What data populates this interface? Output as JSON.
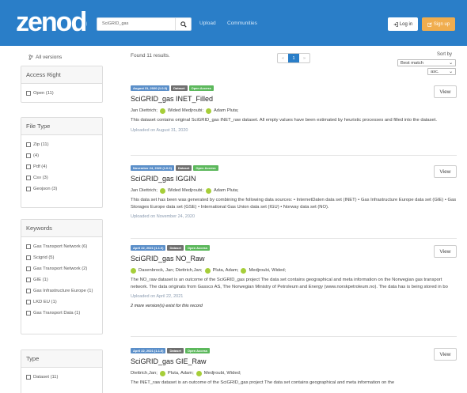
{
  "header": {
    "logo_text": "zenodo",
    "search_value": "SciGRID_gas",
    "search_icon": "search-icon",
    "nav": [
      "Upload",
      "Communities"
    ],
    "login_label": "Log in",
    "signup_label": "Sign up",
    "colors": {
      "header_bg": "#2a7ec8",
      "signup_bg": "#f0ad4e"
    }
  },
  "sidebar": {
    "all_versions": "All versions",
    "access_right": {
      "title": "Access Right",
      "items": [
        "Open (11)"
      ]
    },
    "file_type": {
      "title": "File Type",
      "items": [
        "Zip (11)",
        "(4)",
        "Pdf (4)",
        "Csv (3)",
        "Geojson (3)"
      ]
    },
    "keywords": {
      "title": "Keywords",
      "items": [
        "Gas Transport Network (6)",
        "Scigrid (5)",
        "Gas Transport Network (2)",
        "GIE (1)",
        "Gas Infrastructure Europe (1)",
        "LKD EU (1)",
        "Gas Transport Data (1)"
      ]
    },
    "type": {
      "title": "Type",
      "items": [
        "Dataset (11)"
      ]
    }
  },
  "results": {
    "found_text": "Found 11 results.",
    "pager": {
      "prev": "«",
      "current": "1",
      "next": "»"
    },
    "sort_by_label": "Sort by",
    "sort_value": "Best match",
    "order_value": "asc."
  },
  "records": [
    {
      "date_badge": "August 31, 2020 (1.0.0)",
      "type_badge": "Dataset",
      "access_badge": "Open Access",
      "title": "SciGRID_gas INET_Filled",
      "authors": [
        "Jan Diettrich;",
        "Wided Medjroubi;",
        "Adam Pluta;"
      ],
      "orcid_flags": [
        false,
        true,
        true
      ],
      "description": "This dataset contains original SciGRID_gas INET_raw dataset. All empty values have been estimated by heuristic processes and filled into the dataset.",
      "uploaded": "Uploaded on August 31, 2020",
      "more": "",
      "view_label": "View"
    },
    {
      "date_badge": "November 24, 2020 (1.0.0)",
      "type_badge": "Dataset",
      "access_badge": "Open Access",
      "title": "SciGRID_gas IGGIN",
      "authors": [
        "Jan Diettrich;",
        "Wided Medjroubi;",
        "Adam Pluta;"
      ],
      "orcid_flags": [
        false,
        true,
        true
      ],
      "description": "This data set has been was generated by combining the following data sources: • InternetDaten data set (INET) • Gas Infrastructure Europe data set (GIE) • Gas Storages Europe data set (GSE) • International Gas Union data set (IGU) • Norway data set (NO).",
      "uploaded": "Uploaded on November 24, 2020",
      "more": "",
      "view_label": "View"
    },
    {
      "date_badge": "April 22, 2021 (1.1.0)",
      "type_badge": "Dataset",
      "access_badge": "Open Access",
      "title": "SciGRID_gas NO_Raw",
      "authors": [
        "Dasenbrock, Jan; Diettrich,Jan;",
        "Pluta, Adam;",
        "Medjroubi, Wided;"
      ],
      "orcid_flags": [
        true,
        true,
        true
      ],
      "description": "The NO_raw dataset is an outcome of the SciGRID_gas project The data set contains geographical and meta information on the Norwegian gas transport network. The data originats from Gassco AS, The Norwegian Ministry of Petroleum and Energy (www.norskpetroleum.no). The data has is being stored in bo",
      "uploaded": "Uploaded on April 22, 2021",
      "more": "2 more version(s) exist for this record",
      "view_label": "View"
    },
    {
      "date_badge": "April 22, 2021 (1.1.0)",
      "type_badge": "Dataset",
      "access_badge": "Open Access",
      "title": "SciGRID_gas GIE_Raw",
      "authors": [
        "Diettrich,Jan;",
        "Pluta, Adam;",
        "Medjroubi, Wided;"
      ],
      "orcid_flags": [
        false,
        true,
        true
      ],
      "description": "The INET_raw dataset is an outcome of the SciGRID_gas project The data set contains geographical and meta information on the",
      "uploaded": "",
      "more": "",
      "view_label": "View"
    }
  ]
}
